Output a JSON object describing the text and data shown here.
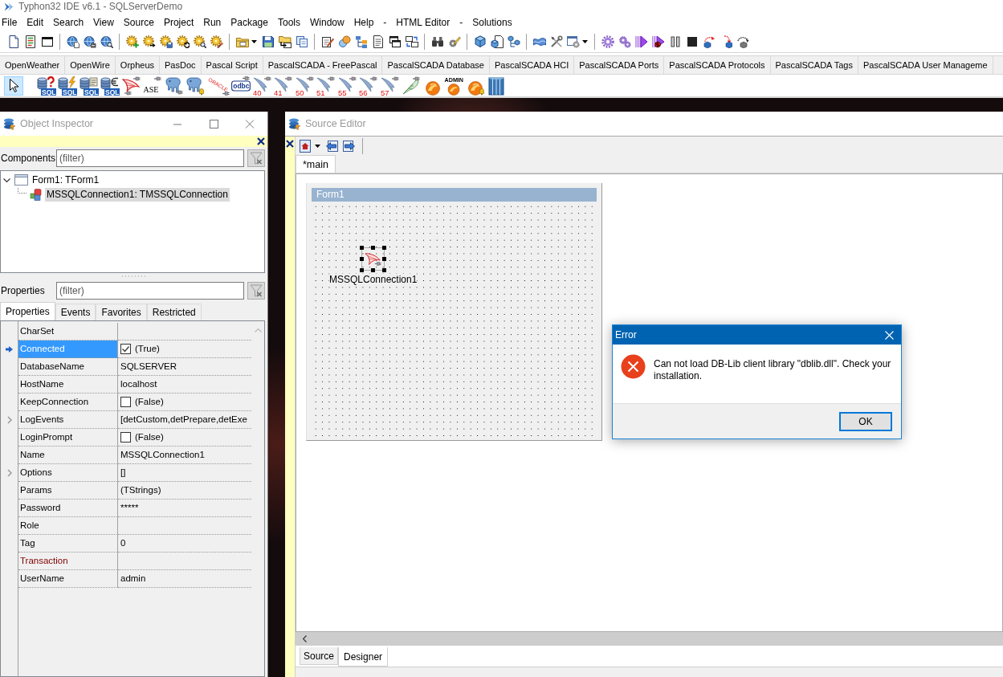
{
  "app": {
    "title": "Typhon32 IDE v6.1 - SQLServerDemo"
  },
  "menu_bar": {
    "items": [
      "File",
      "Edit",
      "Search",
      "View",
      "Source",
      "Project",
      "Run",
      "Package",
      "Tools",
      "Window",
      "Help",
      "-",
      "HTML Editor",
      "-",
      "Solutions"
    ]
  },
  "component_palette": {
    "tabs": [
      {
        "label": "OpenWeather",
        "selected": false
      },
      {
        "label": "OpenWire",
        "selected": false
      },
      {
        "label": "Orpheus",
        "selected": false
      },
      {
        "label": "PasDoc",
        "selected": false
      },
      {
        "label": "Pascal Script",
        "selected": false
      },
      {
        "label": "PascalSCADA - FreePascal",
        "selected": false
      },
      {
        "label": "PascalSCADA Database",
        "selected": false
      },
      {
        "label": "PascalSCADA HCI",
        "selected": false
      },
      {
        "label": "PascalSCADA Ports",
        "selected": false
      },
      {
        "label": "PascalSCADA Protocols",
        "selected": false
      },
      {
        "label": "PascalSCADA Tags",
        "selected": false
      },
      {
        "label": "PascalSCADA User Manageme",
        "selected": false
      }
    ],
    "pointer": {
      "selected": true
    },
    "components": [
      {
        "kind": "db-question",
        "badge": "SQL"
      },
      {
        "kind": "db-lightning",
        "badge": "SQL"
      },
      {
        "kind": "db-scroll",
        "badge": "SQL"
      },
      {
        "kind": "db-euro",
        "badge": "SQL"
      },
      {
        "kind": "sail-plug"
      },
      {
        "kind": "text-plug",
        "badge": "ASE"
      },
      {
        "kind": "elephant-plug"
      },
      {
        "kind": "elephant-bell"
      },
      {
        "kind": "rotated-text",
        "badge": "ORACLE"
      },
      {
        "kind": "boxed-text",
        "badge": "odbc"
      },
      {
        "kind": "dolphin",
        "badge": "40"
      },
      {
        "kind": "dolphin",
        "badge": "41"
      },
      {
        "kind": "dolphin",
        "badge": "50"
      },
      {
        "kind": "dolphin",
        "badge": "51"
      },
      {
        "kind": "dolphin",
        "badge": "55"
      },
      {
        "kind": "dolphin",
        "badge": "56"
      },
      {
        "kind": "dolphin",
        "badge": "57"
      },
      {
        "kind": "feather"
      },
      {
        "kind": "flame"
      },
      {
        "kind": "flame",
        "badge": "ADMIN"
      },
      {
        "kind": "flame-bell"
      },
      {
        "kind": "cylinders"
      }
    ]
  },
  "object_inspector": {
    "title": "Object Inspector",
    "components_filter": {
      "label": "Components",
      "placeholder": "(filter)"
    },
    "tree": [
      {
        "label": "Form1: TForm1",
        "expanded": true,
        "selected": false,
        "children": [
          {
            "label": "MSSQLConnection1: TMSSQLConnection",
            "selected": true
          }
        ]
      }
    ],
    "properties_filter": {
      "label": "Properties",
      "placeholder": "(filter)"
    },
    "tabs": [
      {
        "label": "Properties",
        "selected": true
      },
      {
        "label": "Events",
        "selected": false
      },
      {
        "label": "Favorites",
        "selected": false
      },
      {
        "label": "Restricted",
        "selected": false
      }
    ],
    "properties": [
      {
        "name": "CharSet",
        "kind": "text",
        "expandable": false,
        "selected": false,
        "reference": false
      },
      {
        "name": "Connected",
        "kind": "checkbox",
        "checked": true,
        "value": "(True)",
        "expandable": false,
        "selected": true,
        "reference": false
      },
      {
        "name": "DatabaseName",
        "kind": "text",
        "value": "SQLSERVER",
        "expandable": false,
        "selected": false,
        "reference": false
      },
      {
        "name": "HostName",
        "kind": "text",
        "value": "localhost",
        "expandable": false,
        "selected": false,
        "reference": false
      },
      {
        "name": "KeepConnection",
        "kind": "checkbox",
        "checked": false,
        "value": "(False)",
        "expandable": false,
        "selected": false,
        "reference": false
      },
      {
        "name": "LogEvents",
        "kind": "text",
        "value": "[detCustom,detPrepare,detExe",
        "expandable": true,
        "selected": false,
        "reference": false
      },
      {
        "name": "LoginPrompt",
        "kind": "checkbox",
        "checked": false,
        "value": "(False)",
        "expandable": false,
        "selected": false,
        "reference": false
      },
      {
        "name": "Name",
        "kind": "text",
        "value": "MSSQLConnection1",
        "expandable": false,
        "selected": false,
        "reference": false
      },
      {
        "name": "Options",
        "kind": "text",
        "value": "[]",
        "expandable": true,
        "selected": false,
        "reference": false
      },
      {
        "name": "Params",
        "kind": "text",
        "value": "(TStrings)",
        "expandable": false,
        "selected": false,
        "reference": false
      },
      {
        "name": "Password",
        "kind": "text",
        "value": "*****",
        "expandable": false,
        "selected": false,
        "reference": false
      },
      {
        "name": "Role",
        "kind": "text",
        "expandable": false,
        "selected": false,
        "reference": false
      },
      {
        "name": "Tag",
        "kind": "text",
        "value": "0",
        "expandable": false,
        "selected": false,
        "reference": false
      },
      {
        "name": "Transaction",
        "kind": "text",
        "expandable": false,
        "selected": false,
        "reference": true
      },
      {
        "name": "UserName",
        "kind": "text",
        "value": "admin",
        "expandable": false,
        "selected": false,
        "reference": false
      }
    ]
  },
  "source_editor": {
    "title": "Source Editor",
    "tabs": [
      {
        "label": "*main",
        "selected": true
      }
    ],
    "form": {
      "caption": "Form1",
      "components": [
        {
          "label": "MSSQLConnection1",
          "selected": true
        }
      ]
    },
    "view_tabs": [
      {
        "label": "Source",
        "selected": false
      },
      {
        "label": "Designer",
        "selected": true
      }
    ]
  },
  "error_dialog": {
    "title": "Error",
    "message": "Can not load DB-Lib client library \"dblib.dll\". Check your installation.",
    "buttons": [
      {
        "label": "OK",
        "focused": true
      }
    ]
  }
}
